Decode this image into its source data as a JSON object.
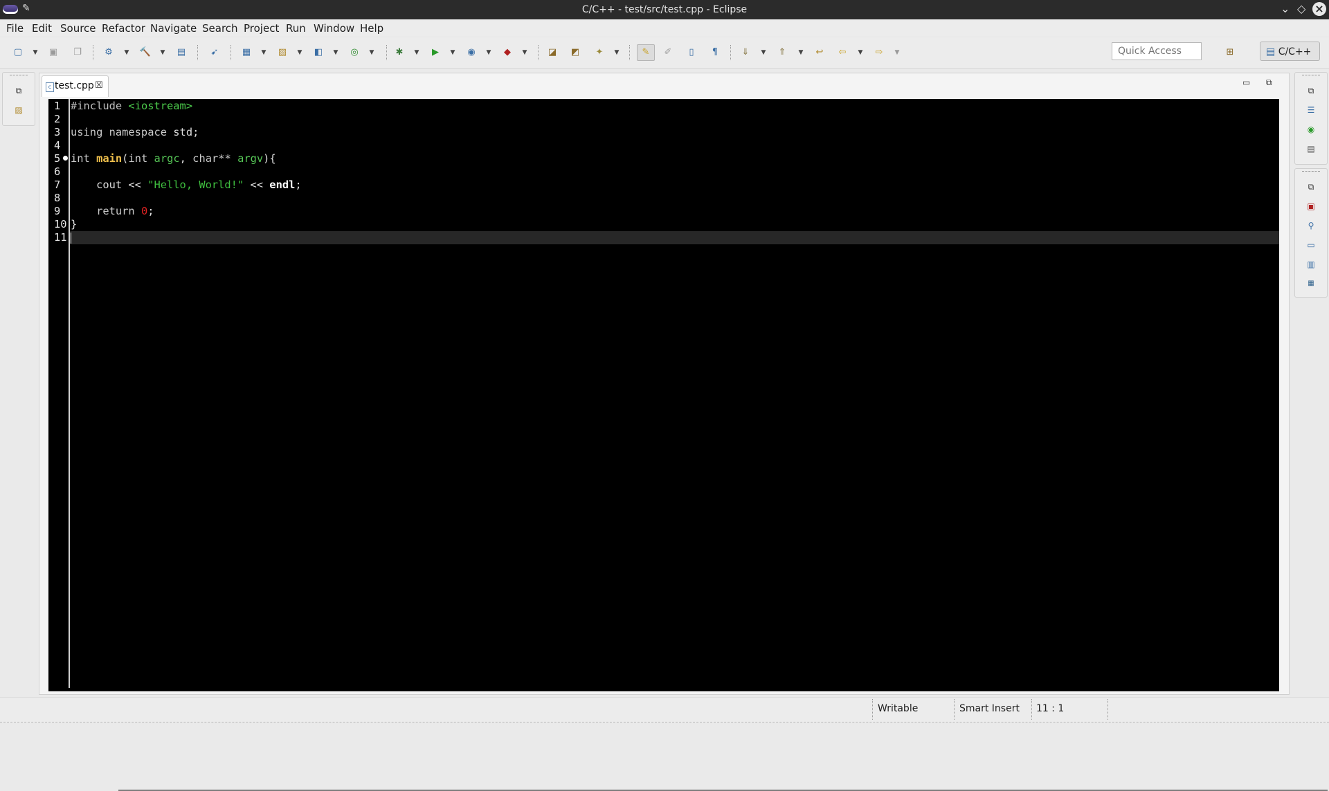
{
  "window": {
    "title": "C/C++ - test/src/test.cpp - Eclipse"
  },
  "menu": [
    "File",
    "Edit",
    "Source",
    "Refactor",
    "Navigate",
    "Search",
    "Project",
    "Run",
    "Window",
    "Help"
  ],
  "toolbar": {
    "quick_access_placeholder": "Quick Access",
    "perspective_label": "C/C++"
  },
  "editor": {
    "tab_label": "test.cpp",
    "lines": [
      {
        "n": "1",
        "html": "<span class='pp'>#include</span> <span class='inc'>&lt;iostream&gt;</span>"
      },
      {
        "n": "2",
        "html": ""
      },
      {
        "n": "3",
        "html": "<span class='kw'>using namespace</span> <span class='id'>std;</span>"
      },
      {
        "n": "4",
        "html": ""
      },
      {
        "n": "5",
        "html": "<span class='kw'>int</span> <span class='fn'>main</span><span class='id'>(</span><span class='kw'>int</span> <span class='par'>argc</span><span class='id'>, </span><span class='kw'>char**</span> <span class='par'>argv</span><span class='id'>){</span>"
      },
      {
        "n": "6",
        "html": ""
      },
      {
        "n": "7",
        "html": "    <span class='id'>cout &lt;&lt; </span><span class='str'>\"Hello, World!\"</span><span class='id'> &lt;&lt; </span><span class='bold'>endl</span><span class='id'>;</span>"
      },
      {
        "n": "8",
        "html": ""
      },
      {
        "n": "9",
        "html": "    <span class='kw'>return</span> <span class='num'>0</span><span class='id'>;</span>"
      },
      {
        "n": "10",
        "html": "<span class='id'>}</span>"
      },
      {
        "n": "11",
        "html": ""
      }
    ]
  },
  "status": {
    "writable": "Writable",
    "insert_mode": "Smart Insert",
    "position": "11 : 1"
  }
}
